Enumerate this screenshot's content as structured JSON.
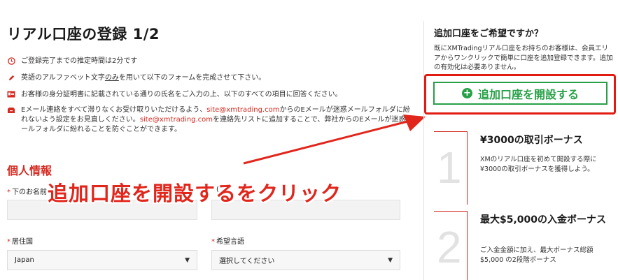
{
  "form": {
    "title": "リアル口座の登録 1/2",
    "notes": {
      "time": "ご登録完了までの推定時間は2分です",
      "alphabet_prefix": "英語のアルファベット文字",
      "alphabet_emph": "のみ",
      "alphabet_suffix": "を用いて以下のフォームを完成させて下さい。",
      "id_doc": "お客様の身分証明書に記載されている通りの氏名をご入力の上、以下のすべての項目に回答ください。",
      "email_1": "Eメール連絡をすべて滞りなくお受け取りいただけるよう、",
      "email_link1": "site@xmtrading.com",
      "email_2": "からのEメールが迷惑メールフォルダに紛れないよう設定をお見直しください。",
      "email_link2": "site@xmtrading.com",
      "email_3": "を連絡先リストに追加することで、弊社からのEメールが迷惑メールフォルダに紛れることを防ぐことができます。"
    },
    "section_personal": "個人情報",
    "fields": {
      "first_name_label": "下のお名前",
      "last_name_label": "(",
      "country_label": "居住国",
      "country_value": "Japan",
      "language_label": "希望言語",
      "language_value": "選択してください",
      "required_mark": "*"
    }
  },
  "instruction": "追加口座を開設するをクリック",
  "sidebar": {
    "title": "追加口座をご希望ですか？",
    "description_1": "既にXMTradingリアル口座をお持ちのお客様は、会員エリアからワンクリックで簡単に口座を追加登録できます。",
    "description_2": "追加の有効化は必要ありません。",
    "cta_label": "追加口座を開設する",
    "bonuses": [
      {
        "number": "1",
        "title": "¥3000の取引ボーナス",
        "description": "XMのリアル口座を初めて開設する際に¥3000の取引ボーナスを獲得しよう。"
      },
      {
        "number": "2",
        "title": "最大$5,000の入金ボーナス",
        "description": "ご入金金額に加え、最大ボーナス総額$5,000 の2段階ボーナス"
      }
    ]
  },
  "colors": {
    "accent_red": "#d42a20",
    "cta_green": "#27a047",
    "frame_red": "#e21b12"
  }
}
